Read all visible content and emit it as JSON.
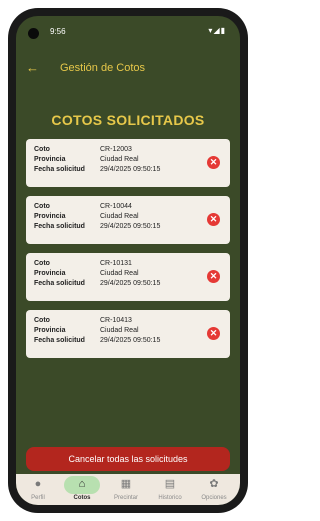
{
  "status_bar": {
    "time": "9:56",
    "icons": "▾◢▮"
  },
  "app_bar": {
    "title": "Gestión de Cotos",
    "back_icon": "arrow-left-icon"
  },
  "heading": "COTOS SOLICITADOS",
  "labels": {
    "coto": "Coto",
    "provincia": "Provincia",
    "fecha": "Fecha solicitud"
  },
  "cards": [
    {
      "coto": "CR-12003",
      "provincia": "Ciudad Real",
      "fecha": "29/4/2025 09:50:15"
    },
    {
      "coto": "CR-10044",
      "provincia": "Ciudad Real",
      "fecha": "29/4/2025 09:50:15"
    },
    {
      "coto": "CR-10131",
      "provincia": "Ciudad Real",
      "fecha": "29/4/2025 09:50:15"
    },
    {
      "coto": "CR-10413",
      "provincia": "Ciudad Real",
      "fecha": "29/4/2025 09:50:15"
    }
  ],
  "cancel_all_label": "Cancelar todas las solicitudes",
  "nav": [
    {
      "label": "Perfil",
      "icon": "person-icon",
      "active": false
    },
    {
      "label": "Cotos",
      "icon": "home-icon",
      "active": true
    },
    {
      "label": "Precintar",
      "icon": "qr-code-icon",
      "active": false
    },
    {
      "label": "Historico",
      "icon": "calendar-icon",
      "active": false
    },
    {
      "label": "Opciones",
      "icon": "gear-icon",
      "active": false
    }
  ],
  "colors": {
    "background": "#3b4a28",
    "accent": "#e7c84a",
    "danger": "#b3261e",
    "card": "#f3efe8"
  }
}
